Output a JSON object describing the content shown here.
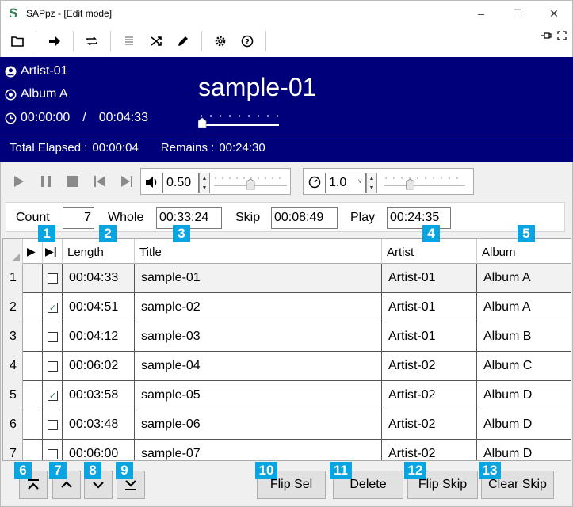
{
  "window": {
    "title": "SAPpz - [Edit mode]",
    "minimize": "–",
    "maximize": "☐",
    "close": "✕"
  },
  "toolbar": {
    "icons": [
      "folder-icon",
      "arrow-right-icon",
      "repeat-icon",
      "list-icon",
      "shuffle-icon",
      "pencil-icon",
      "gear-icon",
      "help-icon",
      "pin-icon",
      "fullscreen-icon"
    ]
  },
  "now_playing": {
    "artist": "Artist-01",
    "album": "Album A",
    "current_time": "00:00:00",
    "separator": "/",
    "total_time": "00:04:33",
    "title": "sample-01",
    "seek_fraction": 0.0
  },
  "totals": {
    "elapsed_label": "Total Elapsed :",
    "elapsed_value": "00:00:04",
    "remains_label": "Remains :",
    "remains_value": "00:24:30"
  },
  "controls": {
    "volume": "0.50",
    "volume_fraction": 0.5,
    "speed": "1.0",
    "speed_fraction": 0.3
  },
  "stats": {
    "count_label": "Count",
    "count_value": "7",
    "whole_label": "Whole",
    "whole_value": "00:33:24",
    "skip_label": "Skip",
    "skip_value": "00:08:49",
    "play_label": "Play",
    "play_value": "00:24:35"
  },
  "table": {
    "headers": {
      "play": "▶",
      "skip": "▶|",
      "length": "Length",
      "title": "Title",
      "artist": "Artist",
      "album": "Album"
    },
    "rows": [
      {
        "num": "1",
        "skip": false,
        "length": "00:04:33",
        "title": "sample-01",
        "artist": "Artist-01",
        "album": "Album A"
      },
      {
        "num": "2",
        "skip": true,
        "length": "00:04:51",
        "title": "sample-02",
        "artist": "Artist-01",
        "album": "Album A"
      },
      {
        "num": "3",
        "skip": false,
        "length": "00:04:12",
        "title": "sample-03",
        "artist": "Artist-01",
        "album": "Album B"
      },
      {
        "num": "4",
        "skip": false,
        "length": "00:06:02",
        "title": "sample-04",
        "artist": "Artist-02",
        "album": "Album C"
      },
      {
        "num": "5",
        "skip": true,
        "length": "00:03:58",
        "title": "sample-05",
        "artist": "Artist-02",
        "album": "Album D"
      },
      {
        "num": "6",
        "skip": false,
        "length": "00:03:48",
        "title": "sample-06",
        "artist": "Artist-02",
        "album": "Album D"
      },
      {
        "num": "7",
        "skip": false,
        "length": "00:06:00",
        "title": "sample-07",
        "artist": "Artist-02",
        "album": "Album D"
      }
    ]
  },
  "badges": [
    "1",
    "2",
    "3",
    "4",
    "5",
    "6",
    "7",
    "8",
    "9",
    "10",
    "11",
    "12",
    "13"
  ],
  "buttons": {
    "flip_sel": "Flip Sel",
    "delete": "Delete",
    "flip_skip": "Flip Skip",
    "clear_skip": "Clear Skip"
  },
  "colors": {
    "info_bg": "#00007a",
    "badge": "#0aa4e0"
  }
}
